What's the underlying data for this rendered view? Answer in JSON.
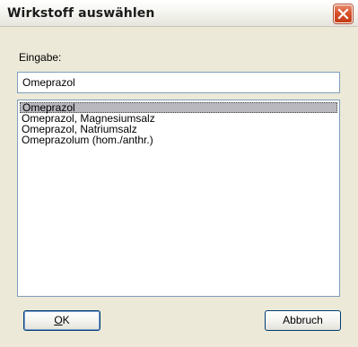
{
  "dialog": {
    "title": "Wirkstoff auswählen"
  },
  "input": {
    "label": "Eingabe:",
    "value": "Omeprazol"
  },
  "list": {
    "items": [
      {
        "label": "Omeprazol",
        "selected": true
      },
      {
        "label": "Omeprazol, Magnesiumsalz",
        "selected": false
      },
      {
        "label": "Omeprazol, Natriumsalz",
        "selected": false
      },
      {
        "label": "Omeprazolum (hom./anthr.)",
        "selected": false
      }
    ]
  },
  "buttons": {
    "ok_accel": "O",
    "ok_rest": "K",
    "cancel_label": "Abbruch"
  },
  "icons": {
    "close": "close-icon"
  },
  "colors": {
    "dialog_background": "#ece9d8",
    "close_button": "#d9502a",
    "selection_highlight": "#b8b8be",
    "field_border": "#7f9db9"
  }
}
